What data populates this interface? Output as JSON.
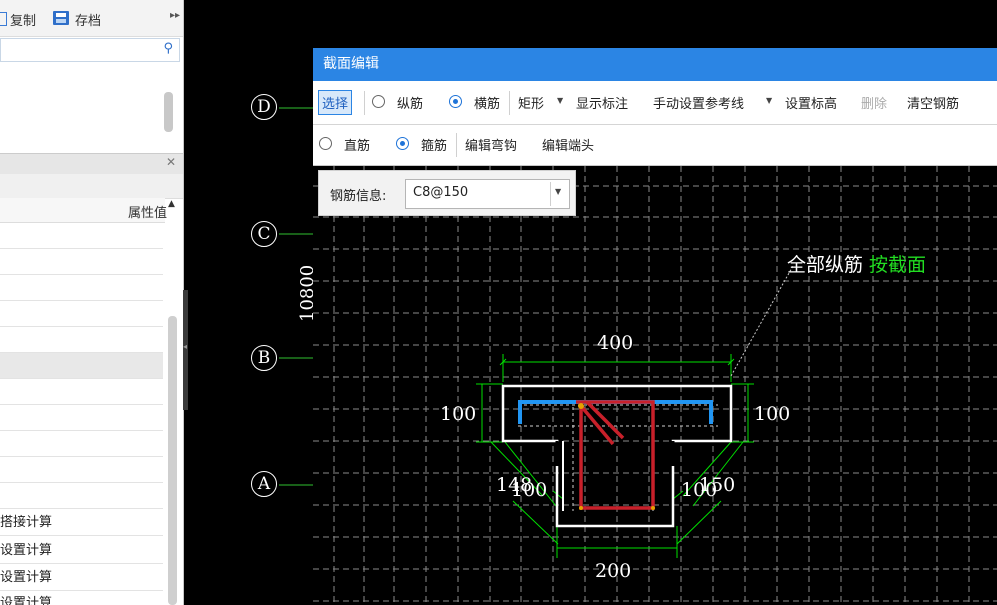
{
  "left_panel": {
    "toolbar": {
      "copy_label": "复制",
      "save_label": "存档"
    },
    "column_header": "属性值",
    "rows": [
      "",
      "",
      "",
      "",
      "",
      "",
      "",
      "",
      "",
      "",
      "",
      "搭接计算",
      "设置计算",
      "设置计算",
      "设置计算"
    ]
  },
  "dialog": {
    "title": "截面编辑",
    "toolbar1": {
      "select": "选择",
      "longitudinal": "纵筋",
      "transverse": "横筋",
      "rect": "矩形",
      "show_label": "显示标注",
      "manual_ref": "手动设置参考线",
      "set_elev": "设置标高",
      "delete": "删除",
      "clear": "清空钢筋"
    },
    "toolbar2": {
      "straight": "直筋",
      "stirrup": "箍筋",
      "edit_hook": "编辑弯钩",
      "edit_end": "编辑端头"
    },
    "rebar_info": {
      "label": "钢筋信息:",
      "value": "C8@150"
    }
  },
  "drawing": {
    "axes": [
      "D",
      "C",
      "B",
      "A"
    ],
    "vertical_dimension": "10800",
    "annotation_white": "全部纵筋",
    "annotation_green": "按截面",
    "dims": {
      "top_width": "400",
      "left_flange": "100",
      "right_flange": "100",
      "left_offset_a": "148",
      "left_offset_b": "100",
      "right_offset_a": "100",
      "right_offset_b": "150",
      "bottom_width": "200"
    }
  },
  "colors": {
    "title_bar": "#2b85e4",
    "rebar_blue": "#2196f3",
    "rebar_red": "#c8202a",
    "dim_green": "#00ff00"
  }
}
